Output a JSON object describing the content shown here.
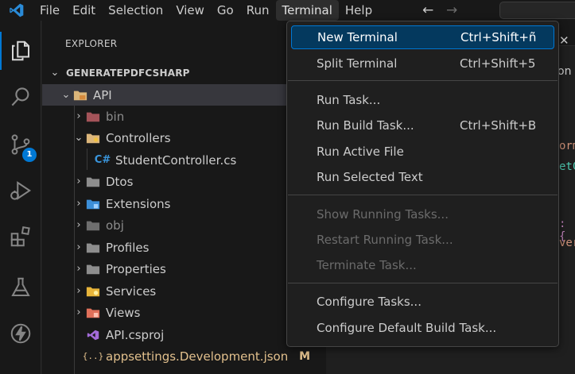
{
  "menubar": {
    "items": [
      "File",
      "Edit",
      "Selection",
      "View",
      "Go",
      "Run",
      "Terminal",
      "Help"
    ],
    "active": "Terminal"
  },
  "activity": {
    "source_control_badge": "1"
  },
  "sidebar": {
    "title": "EXPLORER",
    "root": "GENERATEPDFCSHARP",
    "rows": [
      {
        "label": "API",
        "chev": "⌄"
      },
      {
        "label": "bin",
        "chev": "›"
      },
      {
        "label": "Controllers",
        "chev": "⌄"
      },
      {
        "label": "StudentController.cs",
        "chev": ""
      },
      {
        "label": "Dtos",
        "chev": "›"
      },
      {
        "label": "Extensions",
        "chev": "›"
      },
      {
        "label": "obj",
        "chev": "›"
      },
      {
        "label": "Profiles",
        "chev": "›"
      },
      {
        "label": "Properties",
        "chev": "›"
      },
      {
        "label": "Services",
        "chev": "›"
      },
      {
        "label": "Views",
        "chev": "›"
      },
      {
        "label": "API.csproj",
        "chev": ""
      },
      {
        "label": "appsettings.Development.json",
        "chev": "",
        "badge": "M"
      }
    ],
    "cs_prefix": "C#",
    "json_prefix": "{..}"
  },
  "editor": {
    "close": "✕",
    "peek_lines": [
      "on",
      "orm",
      "etC",
      ": {",
      "ver"
    ]
  },
  "terminal_menu": {
    "groups": [
      [
        {
          "label": "New Terminal",
          "key": "Ctrl+Shift+ñ",
          "highlight": true
        },
        {
          "label": "Split Terminal",
          "key": "Ctrl+Shift+5"
        }
      ],
      [
        {
          "label": "Run Task...",
          "key": ""
        },
        {
          "label": "Run Build Task...",
          "key": "Ctrl+Shift+B"
        },
        {
          "label": "Run Active File",
          "key": ""
        },
        {
          "label": "Run Selected Text",
          "key": ""
        }
      ],
      [
        {
          "label": "Show Running Tasks...",
          "key": "",
          "disabled": true
        },
        {
          "label": "Restart Running Task...",
          "key": "",
          "disabled": true
        },
        {
          "label": "Terminate Task...",
          "key": "",
          "disabled": true
        }
      ],
      [
        {
          "label": "Configure Tasks...",
          "key": ""
        },
        {
          "label": "Configure Default Build Task...",
          "key": ""
        }
      ]
    ]
  },
  "colors": {
    "accent": "#0078d4",
    "menu_highlight": "#04395e",
    "modified": "#e2c08d",
    "folder": "#dcb67a"
  }
}
